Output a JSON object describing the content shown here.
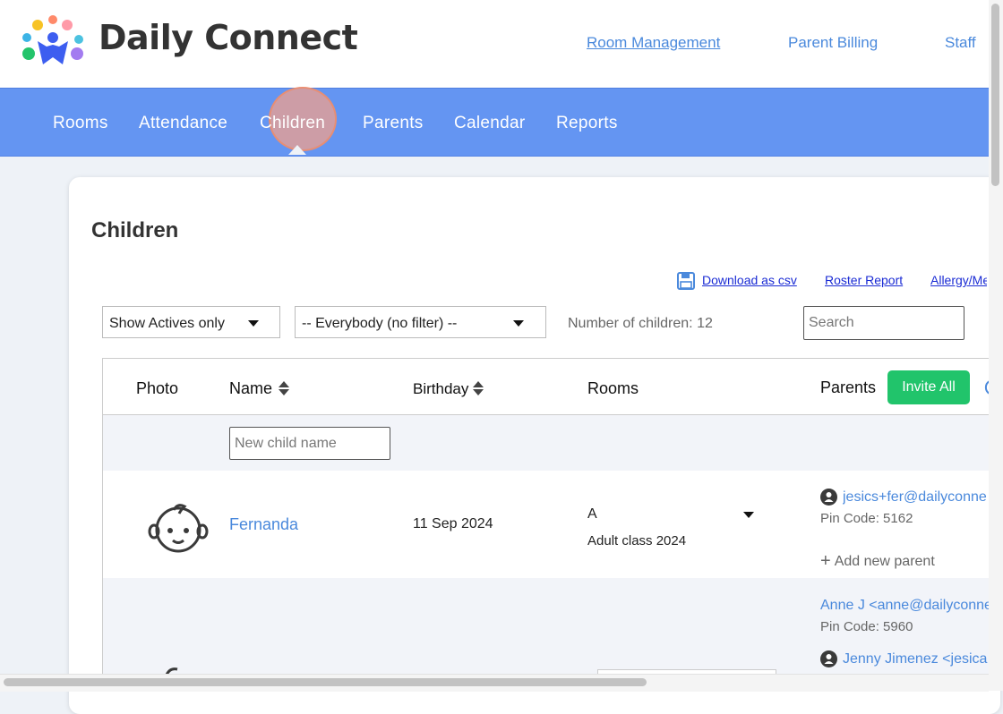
{
  "brand": {
    "name": "Daily Connect"
  },
  "top_links": [
    {
      "label": "Room Management"
    },
    {
      "label": "Parent Billing"
    },
    {
      "label": "Staff"
    }
  ],
  "nav": {
    "items": [
      {
        "label": "Rooms"
      },
      {
        "label": "Attendance"
      },
      {
        "label": "Children"
      },
      {
        "label": "Parents"
      },
      {
        "label": "Calendar"
      },
      {
        "label": "Reports"
      }
    ],
    "active": "Children"
  },
  "page": {
    "title": "Children"
  },
  "actions": {
    "download_csv": "Download as csv",
    "roster_report": "Roster Report",
    "allergy": "Allergy/Me"
  },
  "filters": {
    "status": "Show Actives only",
    "group": "-- Everybody (no filter) --",
    "count_text": "Number of children: 12",
    "search_placeholder": "Search"
  },
  "table": {
    "headers": {
      "photo": "Photo",
      "name": "Name",
      "birthday": "Birthday",
      "rooms": "Rooms",
      "parents": "Parents"
    },
    "invite_all": "Invite All",
    "new_child_placeholder": "New child name",
    "rows": [
      {
        "name": "Fernanda",
        "birthday": "11 Sep 2024",
        "room": "A",
        "room_class": "Adult class 2024",
        "parents": [
          {
            "email": "jesics+fer@dailyconne",
            "pin": "Pin Code: 5162"
          }
        ],
        "add_parent": "Add new parent"
      },
      {
        "parents": [
          {
            "email": "Anne J <anne@dailyconne",
            "pin": "Pin Code: 5960"
          },
          {
            "email": "Jenny Jimenez <jesica"
          }
        ]
      }
    ]
  },
  "colors": {
    "nav_bg": "#6495f2",
    "link_blue": "#4a89dc",
    "invite_green": "#21c46b"
  }
}
